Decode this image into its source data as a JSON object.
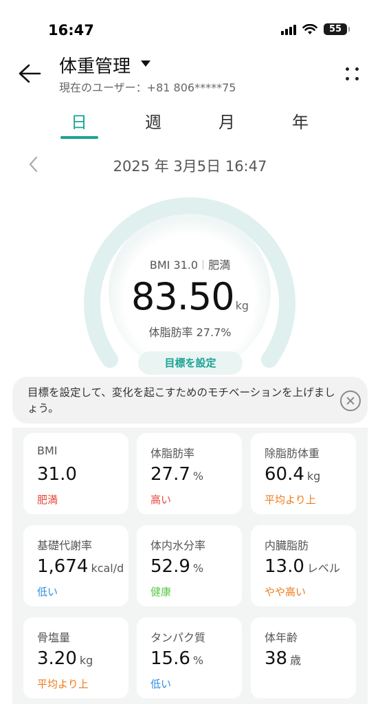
{
  "status_bar": {
    "time": "16:47",
    "battery": "55"
  },
  "header": {
    "title": "体重管理",
    "subtitle": "現在のユーザー：+81 806*****75"
  },
  "tabs": [
    {
      "label": "日",
      "active": true
    },
    {
      "label": "週",
      "active": false
    },
    {
      "label": "月",
      "active": false
    },
    {
      "label": "年",
      "active": false
    }
  ],
  "date": "2025 年 3月5日 16:47",
  "gauge": {
    "bmi_label": "BMI 31.0",
    "bmi_category": "肥満",
    "weight": "83.50",
    "weight_unit": "kg",
    "body_fat": "体脂肪率 27.7%",
    "goal_button": "目標を設定"
  },
  "banner": {
    "text": "目標を設定して、変化を起こすためのモチベーションを上げましょう。"
  },
  "metrics": [
    {
      "label": "BMI",
      "value": "31.0",
      "unit": "",
      "status": "肥満",
      "status_color": "#e8453c"
    },
    {
      "label": "体脂肪率",
      "value": "27.7",
      "unit": "%",
      "status": "高い",
      "status_color": "#e8453c"
    },
    {
      "label": "除脂肪体重",
      "value": "60.4",
      "unit": "kg",
      "status": "平均より上",
      "status_color": "#f07a1a"
    },
    {
      "label": "基礎代謝率",
      "value": "1,674",
      "unit": "kcal/d",
      "status": "低い",
      "status_color": "#2b8be0"
    },
    {
      "label": "体内水分率",
      "value": "52.9",
      "unit": "%",
      "status": "健康",
      "status_color": "#5cc84a"
    },
    {
      "label": "内臓脂肪",
      "value": "13.0",
      "unit": "レベル",
      "status": "やや高い",
      "status_color": "#f07a1a"
    },
    {
      "label": "骨塩量",
      "value": "3.20",
      "unit": "kg",
      "status": "平均より上",
      "status_color": "#f07a1a"
    },
    {
      "label": "タンパク質",
      "value": "15.6",
      "unit": "%",
      "status": "低い",
      "status_color": "#2b8be0"
    },
    {
      "label": "体年齢",
      "value": "38",
      "unit": "歳",
      "status": "",
      "status_color": "#555555"
    }
  ],
  "colors": {
    "accent": "#1aa394",
    "gauge_track": "#dff0ee"
  },
  "icons": {
    "back": "arrow-left-icon",
    "more": "more-dots-icon",
    "prev": "chevron-left-icon",
    "close": "close-circle-icon"
  }
}
